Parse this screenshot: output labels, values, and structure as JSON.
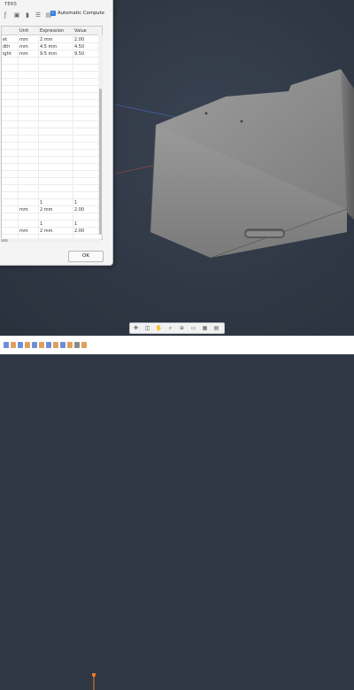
{
  "dialog": {
    "title": "TERS",
    "auto_compute_label": "Automatic Compute",
    "auto_compute_checked": true,
    "columns": [
      "Unit",
      "Expression",
      "Value"
    ],
    "rows": [
      {
        "name": "et",
        "unit": "mm",
        "expression": "2 mm",
        "value": "2.00"
      },
      {
        "name": "dth",
        "unit": "mm",
        "expression": "4.5 mm",
        "value": "4.50"
      },
      {
        "name": "ight",
        "unit": "mm",
        "expression": "9.5 mm",
        "value": "9.50"
      },
      {
        "name": "",
        "unit": "",
        "expression": "1",
        "value": "1"
      },
      {
        "name": "",
        "unit": "mm",
        "expression": "2 mm",
        "value": "2.00"
      },
      {
        "name": "",
        "unit": "",
        "expression": "1",
        "value": "1"
      },
      {
        "name": "",
        "unit": "mm",
        "expression": "2 mm",
        "value": "2.00"
      }
    ],
    "ok_label": "OK"
  },
  "toolbar_icons": [
    "fx-icon",
    "copy-icon",
    "delete-icon",
    "sort-icon",
    "filter-icon"
  ],
  "navbar_icons": [
    "orbit-icon",
    "look-at-icon",
    "pan-icon",
    "zoom-icon",
    "fit-icon",
    "display-settings-icon",
    "grid-icon",
    "viewports-icon"
  ],
  "colors": {
    "viewport_bg": "#2f3744",
    "model_gray": "#8c8c8c",
    "accent": "#2f7de1"
  }
}
